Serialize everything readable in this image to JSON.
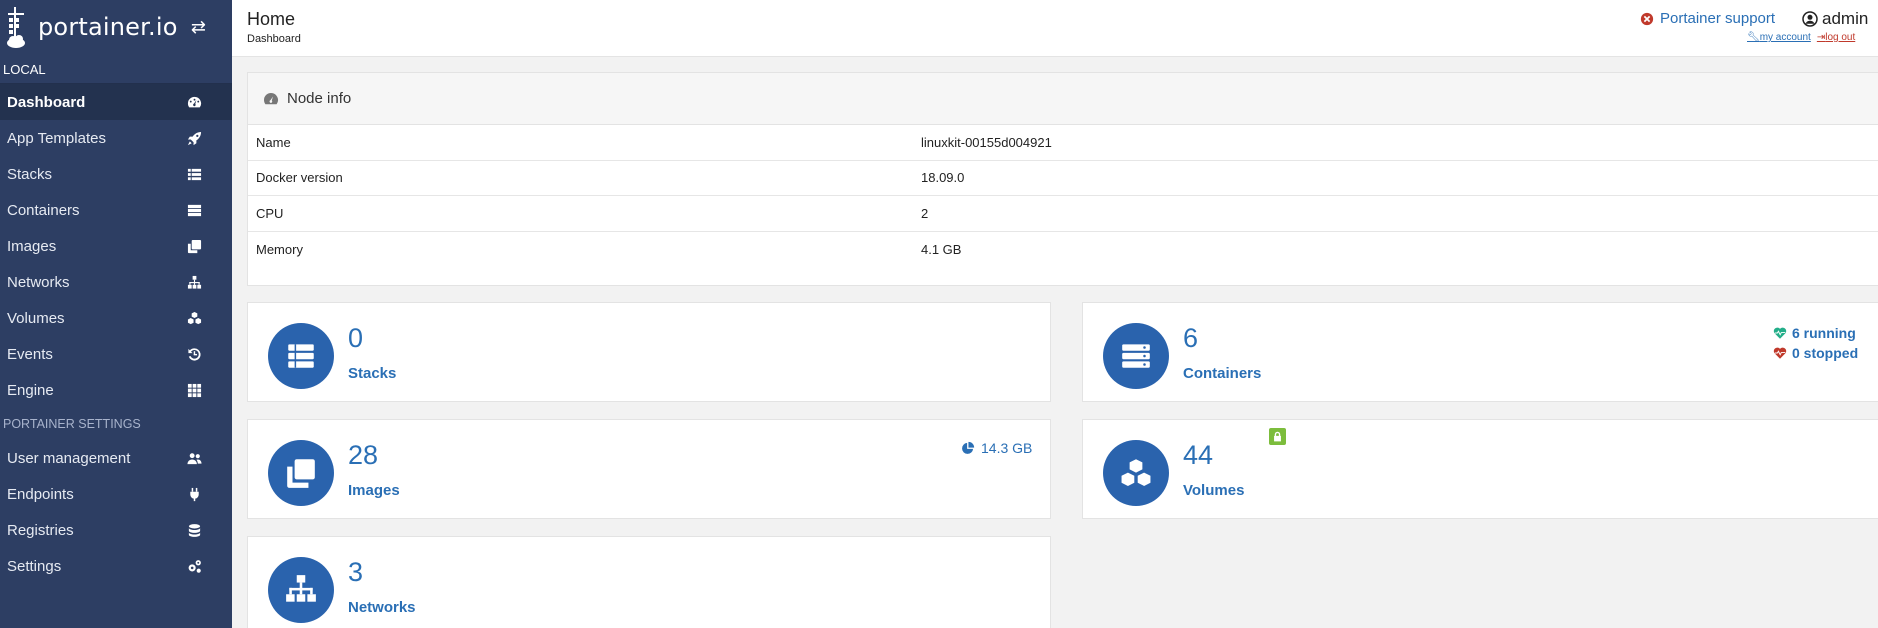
{
  "app": {
    "brand": "portainer.io",
    "endpoint": "LOCAL",
    "colors": {
      "sidebar": "#2d3e63",
      "accent": "#2a6fb5",
      "icon_circle": "#2a63ad",
      "running": "#23ae89",
      "stopped": "#c0392b",
      "lock": "#7cbd3c"
    }
  },
  "sidebar": {
    "items": [
      {
        "label": "Dashboard",
        "icon": "tachometer-icon"
      },
      {
        "label": "App Templates",
        "icon": "rocket-icon"
      },
      {
        "label": "Stacks",
        "icon": "list-icon"
      },
      {
        "label": "Containers",
        "icon": "server-icon"
      },
      {
        "label": "Images",
        "icon": "clone-icon"
      },
      {
        "label": "Networks",
        "icon": "sitemap-icon"
      },
      {
        "label": "Volumes",
        "icon": "cubes-icon"
      },
      {
        "label": "Events",
        "icon": "history-icon"
      },
      {
        "label": "Engine",
        "icon": "th-icon"
      }
    ],
    "settings_title": "PORTAINER SETTINGS",
    "settings_items": [
      {
        "label": "User management",
        "icon": "users-icon"
      },
      {
        "label": "Endpoints",
        "icon": "plug-icon"
      },
      {
        "label": "Registries",
        "icon": "database-icon"
      },
      {
        "label": "Settings",
        "icon": "cogs-icon"
      }
    ]
  },
  "header": {
    "title": "Home",
    "breadcrumb": "Dashboard",
    "support": "Portainer support",
    "user": "admin",
    "my_account": "my account",
    "log_out": "log out"
  },
  "node_info": {
    "title": "Node info",
    "rows": [
      {
        "key": "Name",
        "value": "linuxkit-00155d004921"
      },
      {
        "key": "Docker version",
        "value": "18.09.0"
      },
      {
        "key": "CPU",
        "value": "2"
      },
      {
        "key": "Memory",
        "value": "4.1 GB"
      }
    ]
  },
  "stats": {
    "stacks": {
      "count": "0",
      "label": "Stacks"
    },
    "containers": {
      "count": "6",
      "label": "Containers",
      "running": "6 running",
      "stopped": "0 stopped"
    },
    "images": {
      "count": "28",
      "label": "Images",
      "size": "14.3 GB"
    },
    "volumes": {
      "count": "44",
      "label": "Volumes"
    },
    "networks": {
      "count": "3",
      "label": "Networks"
    }
  }
}
